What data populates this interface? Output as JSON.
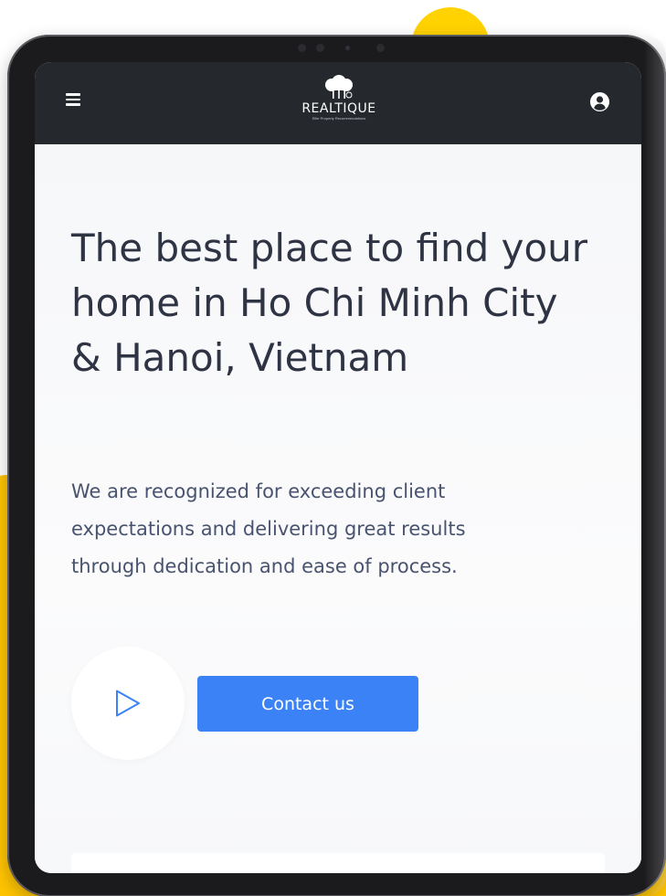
{
  "brand": {
    "name": "REALTIQUE",
    "tagline": "Elite Property Recommendations"
  },
  "navbar": {
    "menu_icon": "hamburger-menu-icon",
    "account_icon": "user-circle-icon"
  },
  "hero": {
    "title": "The best place to find your home in Ho Chi Minh City & Hanoi, Vietnam",
    "description": "We are recognized for exceeding client expectations and delivering great results through dedication and ease of process.",
    "play_icon": "play-icon",
    "contact_label": "Contact us"
  },
  "colors": {
    "navbar_bg": "#25282d",
    "accent_blue": "#3b82f6",
    "accent_yellow": "#ffc400",
    "title_text": "#2f3444",
    "body_text": "#48536f"
  }
}
